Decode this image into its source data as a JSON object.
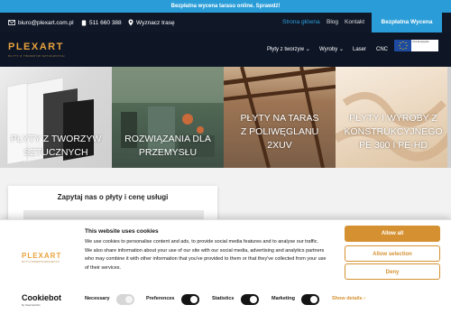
{
  "promo": {
    "text": "Bezpłatna wycena tarasu online. Sprawdź!"
  },
  "contact": {
    "email": "biuro@plexart.com.pl",
    "phone": "511 660 388",
    "route": "Wyznacz trasę",
    "nav": [
      "Strona główna",
      "Blog",
      "Kontakt"
    ],
    "cta": "Bezpłatna Wycena"
  },
  "header": {
    "logo": "PLEXART",
    "logo_sub": "PŁYTY Z TWORZYW SZTUCZNYCH",
    "menu": [
      "Płyty z tworzyw",
      "Wyroby",
      "Laser",
      "CNC"
    ],
    "eu_label": "Unia Europejska"
  },
  "hero": [
    {
      "line1": "PŁYTY Z TWORZYW",
      "line2": "SZTUCZNYCH",
      "line3": ""
    },
    {
      "line1": "ROZWIĄZANIA DLA",
      "line2": "PRZEMYSŁU",
      "line3": ""
    },
    {
      "line1": "PŁYTY NA TARAS",
      "line2": "Z POLIWĘGLANU",
      "line3": "2XUV"
    },
    {
      "line1": "PŁYTY I WYROBY Z",
      "line2": "KONSTRUKCYJNEGO",
      "line3": "PE 300 I PE-HD"
    }
  ],
  "form": {
    "title": "Zapytaj nas o płyty i cenę usługi"
  },
  "cookie": {
    "logo": "PLEXART",
    "title": "This website uses cookies",
    "text": "We use cookies to personalise content and ads, to provide social media features and to analyse our traffic. We also share information about your use of our site with our social media, advertising and analytics partners who may combine it with other information that you've provided to them or that they've collected from your use of their services.",
    "buttons": {
      "allow": "Allow all",
      "selection": "Allow selection",
      "deny": "Deny"
    },
    "brand": "Cookiebot",
    "brand_sub": "by Usercentrics",
    "toggles": {
      "necessary": "Necessary",
      "preferences": "Preferences",
      "statistics": "Statistics",
      "marketing": "Marketing"
    },
    "show_details": "Show details"
  },
  "colors": {
    "brand_blue": "#2a9dd8",
    "cookie_accent": "#d59131",
    "header_bg": "#0e1626"
  }
}
